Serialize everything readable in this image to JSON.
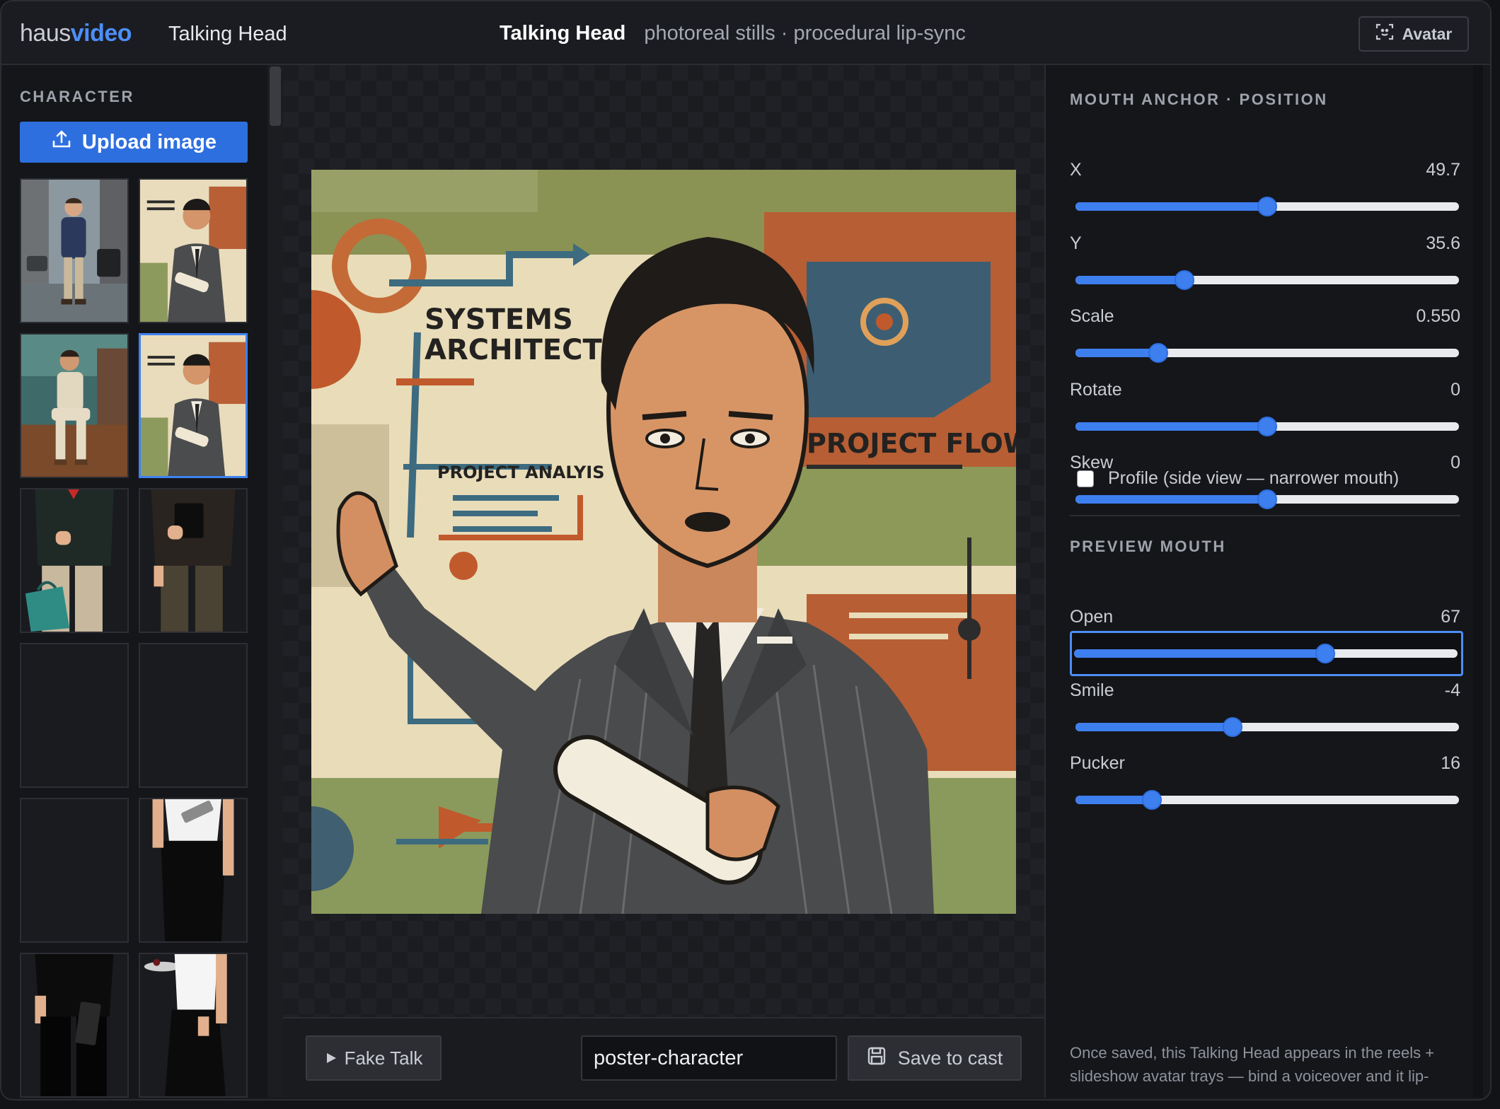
{
  "header": {
    "logo_part1": "haus",
    "logo_part2": "video",
    "app_title": "Talking Head",
    "center_title": "Talking Head",
    "center_subtitle": "photoreal stills · procedural lip-sync",
    "avatar_button": "Avatar"
  },
  "sidebar": {
    "heading": "CHARACTER",
    "upload_label": "Upload image",
    "selected_index": 3,
    "thumbnail_count": 12
  },
  "poster": {
    "text_systems": "SYSTEMS",
    "text_architecture": "ARCHITECTURE",
    "text_project_flow": "PROJECT FLOW",
    "text_project_analysis": "PROJECT ANALYIS"
  },
  "bottom": {
    "fake_talk_label": "Fake Talk",
    "name_value": "poster-character",
    "save_label": "Save to cast"
  },
  "anchor": {
    "heading": "MOUTH ANCHOR · POSITION",
    "controls": [
      {
        "label": "X",
        "value": "49.7",
        "fraction": 0.5
      },
      {
        "label": "Y",
        "value": "35.6",
        "fraction": 0.285
      },
      {
        "label": "Scale",
        "value": "0.550",
        "fraction": 0.215
      },
      {
        "label": "Rotate",
        "value": "0",
        "fraction": 0.5
      },
      {
        "label": "Skew",
        "value": "0",
        "fraction": 0.5
      }
    ],
    "profile_label": "Profile (side view — narrower mouth)",
    "profile_checked": false
  },
  "preview": {
    "heading": "PREVIEW MOUTH",
    "controls": [
      {
        "label": "Open",
        "value": "67",
        "fraction": 0.655
      },
      {
        "label": "Smile",
        "value": "-4",
        "fraction": 0.41
      },
      {
        "label": "Pucker",
        "value": "16",
        "fraction": 0.2
      }
    ]
  },
  "footnote": "Once saved, this Talking Head appears in the reels + slideshow avatar trays — bind a voiceover and it lip-",
  "colors": {
    "accent": "#3e7ff0",
    "upload": "#2e6fe0",
    "background": "#17181c"
  }
}
